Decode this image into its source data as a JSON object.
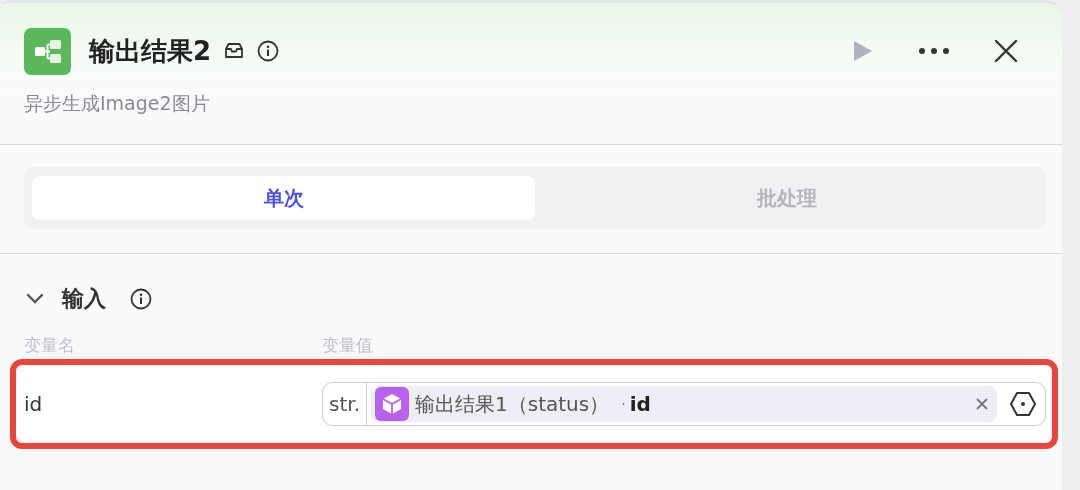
{
  "node": {
    "title": "输出结果2",
    "subtitle": "异步生成Image2图片"
  },
  "tabs": [
    {
      "label": "单次",
      "selected": true
    },
    {
      "label": "批处理",
      "selected": false
    }
  ],
  "section": {
    "title": "输入",
    "expanded": true
  },
  "columns": [
    "变量名",
    "变量值"
  ],
  "rows": [
    {
      "name": "id",
      "highlighted": true,
      "type_tag": "str.",
      "ref": {
        "source": "输出结果1（status）",
        "separator": "·",
        "field": "id"
      }
    }
  ]
}
